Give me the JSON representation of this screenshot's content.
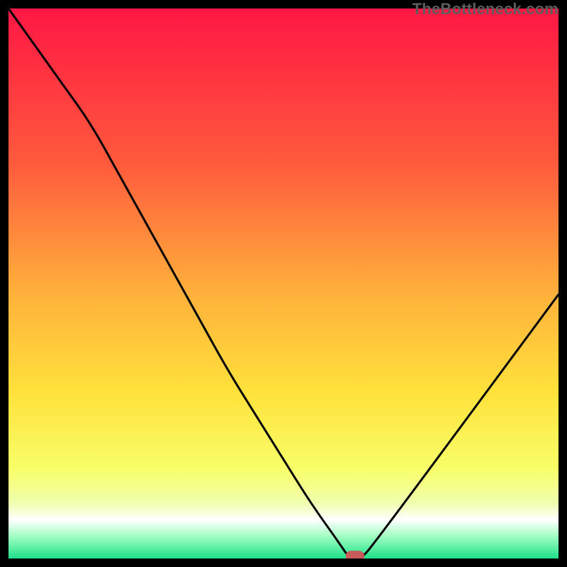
{
  "attribution": "TheBottleneck.com",
  "chart_data": {
    "type": "line",
    "title": "",
    "xlabel": "",
    "ylabel": "",
    "xlim": [
      0,
      100
    ],
    "ylim": [
      0,
      100
    ],
    "grid": false,
    "legend": false,
    "x": [
      0,
      5,
      10,
      15,
      20,
      25,
      30,
      35,
      40,
      45,
      50,
      55,
      60,
      62,
      64,
      66,
      100
    ],
    "values": [
      100,
      93,
      86,
      79,
      70,
      61,
      52,
      43,
      34,
      26,
      18,
      10,
      3,
      0,
      0,
      2,
      48
    ],
    "marker": {
      "x": 63,
      "y": 0.5
    },
    "gradient_stops": [
      {
        "offset": 0,
        "color": "#ff1744"
      },
      {
        "offset": 28,
        "color": "#ff5a3c"
      },
      {
        "offset": 52,
        "color": "#ffb13b"
      },
      {
        "offset": 70,
        "color": "#ffe23b"
      },
      {
        "offset": 84,
        "color": "#f8ff6a"
      },
      {
        "offset": 90,
        "color": "#f0ffb0"
      },
      {
        "offset": 93,
        "color": "#ffffff"
      },
      {
        "offset": 96,
        "color": "#9fffc0"
      },
      {
        "offset": 100,
        "color": "#1fe08a"
      }
    ]
  }
}
